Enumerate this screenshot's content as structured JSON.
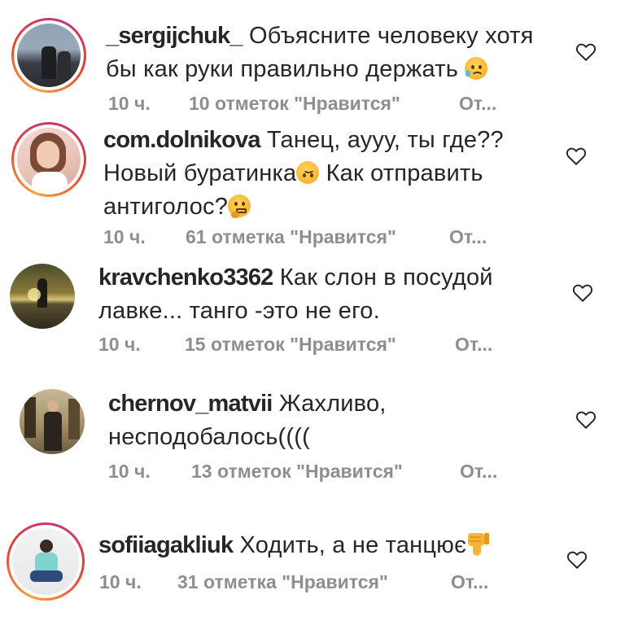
{
  "comments": [
    {
      "username": "_sergijchuk_",
      "line1": "Объясните человеку хотя",
      "line2": "бы как руки правильно держать",
      "line3": "",
      "emoji": "sad-face-emoji",
      "time": "10 ч.",
      "likes": "10 отметок \"Нравится\"",
      "reply": "От..."
    },
    {
      "username": "com.dolnikova",
      "line1": "Танец, аууу, ты где??",
      "line2": "Новый буратинка",
      "line2b": "Как отправить",
      "line3": "антиголос?",
      "emoji": "upside-down-face-emoji",
      "emoji2": "thinking-face-emoji",
      "time": "10 ч.",
      "likes": "61 отметка \"Нравится\"",
      "reply": "От..."
    },
    {
      "username": "kravchenko3362",
      "line1": "Как слон в посудой",
      "line2": "лавке... танго -это не его.",
      "time": "10 ч.",
      "likes": "15 отметок \"Нравится\"",
      "reply": "От..."
    },
    {
      "username": "chernov_matvii",
      "line1": "Жахливо,",
      "line2": "несподобалось((((",
      "time": "10 ч.",
      "likes": "13 отметок \"Нравится\"",
      "reply": "От..."
    },
    {
      "username": "sofiiagakliuk",
      "line1": "Ходить,  а не танцює",
      "emoji": "thumbs-down-emoji",
      "time": "10 ч.",
      "likes": "31 отметка \"Нравится\"",
      "reply": "От..."
    }
  ],
  "icons": {
    "like": "heart-outline-icon"
  },
  "colors": {
    "text": "#262626",
    "meta": "#8e8e8e",
    "story_ring": "#e0433a"
  }
}
